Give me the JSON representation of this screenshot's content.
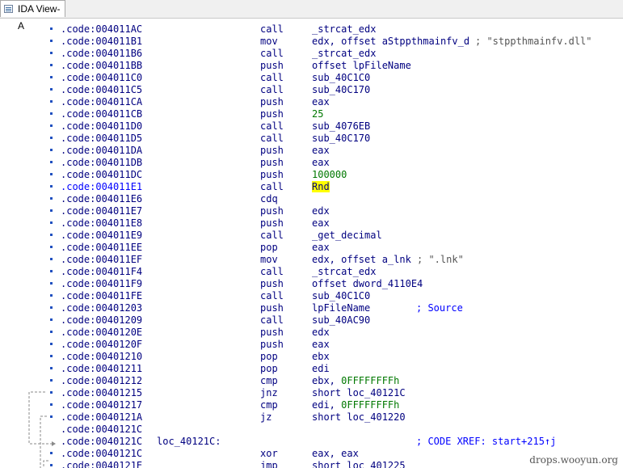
{
  "tab": {
    "title": "IDA View-A",
    "icon": "disassembly-view-icon"
  },
  "lines": [
    {
      "addr": ".code:004011AC",
      "mnem": "call",
      "op": "_strcat_edx",
      "bullet": true
    },
    {
      "addr": ".code:004011B1",
      "mnem": "mov",
      "op": "edx, offset aStppthmainfv_d",
      "cmt": "; \"stppthmainfv.dll\"",
      "cmt_kind": "str",
      "bullet": true
    },
    {
      "addr": ".code:004011B6",
      "mnem": "call",
      "op": "_strcat_edx",
      "bullet": true
    },
    {
      "addr": ".code:004011BB",
      "mnem": "push",
      "op": "offset lpFileName",
      "bullet": true
    },
    {
      "addr": ".code:004011C0",
      "mnem": "call",
      "op": "sub_40C1C0",
      "bullet": true
    },
    {
      "addr": ".code:004011C5",
      "mnem": "call",
      "op": "sub_40C170",
      "bullet": true
    },
    {
      "addr": ".code:004011CA",
      "mnem": "push",
      "op": "eax",
      "bullet": true
    },
    {
      "addr": ".code:004011CB",
      "mnem": "push",
      "op": "25",
      "op_kind": "num",
      "bullet": true
    },
    {
      "addr": ".code:004011D0",
      "mnem": "call",
      "op": "sub_4076EB",
      "bullet": true
    },
    {
      "addr": ".code:004011D5",
      "mnem": "call",
      "op": "sub_40C170",
      "bullet": true
    },
    {
      "addr": ".code:004011DA",
      "mnem": "push",
      "op": "eax",
      "bullet": true
    },
    {
      "addr": ".code:004011DB",
      "mnem": "push",
      "op": "eax",
      "bullet": true
    },
    {
      "addr": ".code:004011DC",
      "mnem": "push",
      "op": "100000",
      "op_kind": "num",
      "bullet": true
    },
    {
      "addr": ".code:004011E1",
      "mnem": "call",
      "op": "Rnd",
      "op_kind": "hl",
      "selected": true,
      "bullet": true
    },
    {
      "addr": ".code:004011E6",
      "mnem": "cdq",
      "op": "",
      "bullet": true
    },
    {
      "addr": ".code:004011E7",
      "mnem": "push",
      "op": "edx",
      "bullet": true
    },
    {
      "addr": ".code:004011E8",
      "mnem": "push",
      "op": "eax",
      "bullet": true
    },
    {
      "addr": ".code:004011E9",
      "mnem": "call",
      "op": "_get_decimal",
      "bullet": true
    },
    {
      "addr": ".code:004011EE",
      "mnem": "pop",
      "op": "eax",
      "bullet": true
    },
    {
      "addr": ".code:004011EF",
      "mnem": "mov",
      "op": "edx, offset a_lnk",
      "cmt": "; \".lnk\"",
      "cmt_kind": "str",
      "bullet": true
    },
    {
      "addr": ".code:004011F4",
      "mnem": "call",
      "op": "_strcat_edx",
      "bullet": true
    },
    {
      "addr": ".code:004011F9",
      "mnem": "push",
      "op": "offset dword_4110E4",
      "bullet": true
    },
    {
      "addr": ".code:004011FE",
      "mnem": "call",
      "op": "sub_40C1C0",
      "bullet": true
    },
    {
      "addr": ".code:00401203",
      "mnem": "push",
      "op": "lpFileName",
      "cmt": "; Source",
      "cmt_kind": "cmt",
      "bullet": true
    },
    {
      "addr": ".code:00401209",
      "mnem": "call",
      "op": "sub_40AC90",
      "bullet": true
    },
    {
      "addr": ".code:0040120E",
      "mnem": "push",
      "op": "edx",
      "bullet": true
    },
    {
      "addr": ".code:0040120F",
      "mnem": "push",
      "op": "eax",
      "bullet": true
    },
    {
      "addr": ".code:00401210",
      "mnem": "pop",
      "op": "ebx",
      "bullet": true
    },
    {
      "addr": ".code:00401211",
      "mnem": "pop",
      "op": "edi",
      "bullet": true
    },
    {
      "addr": ".code:00401212",
      "mnem": "cmp",
      "op": "ebx, ",
      "op_num": "0FFFFFFFFh",
      "bullet": true
    },
    {
      "addr": ".code:00401215",
      "mnem": "jnz",
      "op": "short loc_40121C",
      "bullet": true
    },
    {
      "addr": ".code:00401217",
      "mnem": "cmp",
      "op": "edi, ",
      "op_num": "0FFFFFFFFh",
      "bullet": true
    },
    {
      "addr": ".code:0040121A",
      "mnem": "jz",
      "op": "short loc_401220",
      "bullet": true
    },
    {
      "addr": ".code:0040121C",
      "mnem": "",
      "op": "",
      "bullet": false
    },
    {
      "addr": ".code:0040121C",
      "label": "loc_40121C:",
      "mnem": "",
      "op": "",
      "cmt": "; CODE XREF: start+215↑j",
      "cmt_kind": "cmt",
      "bullet": false
    },
    {
      "addr": ".code:0040121C",
      "mnem": "xor",
      "op": "eax, eax",
      "bullet": true
    },
    {
      "addr": ".code:0040121E",
      "mnem": "jmp",
      "op": "short loc_401225",
      "bullet": true
    }
  ],
  "watermark": "drops.wooyun.org"
}
